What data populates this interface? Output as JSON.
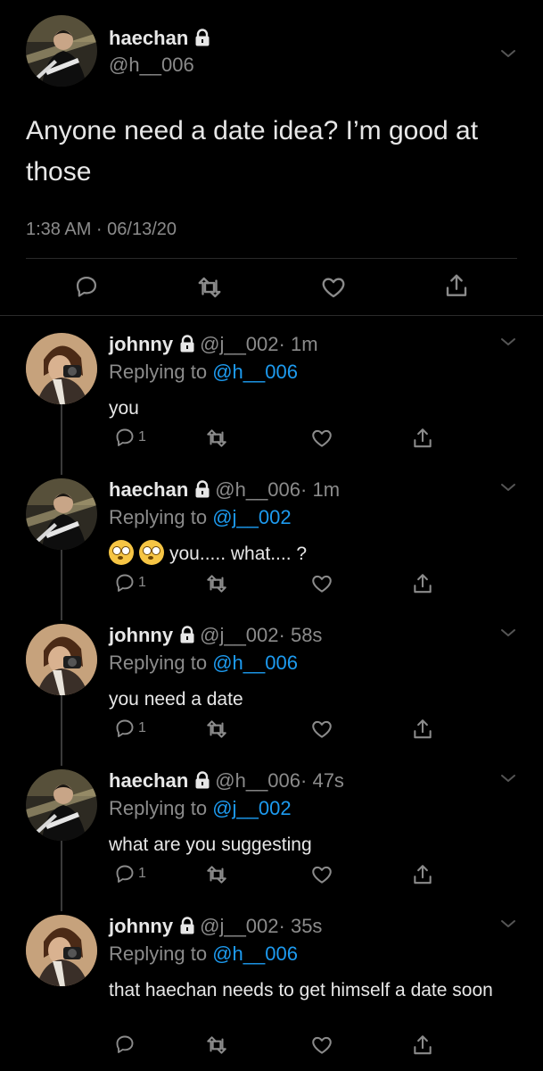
{
  "main_tweet": {
    "name": "haechan",
    "handle": "@h__006",
    "text": "Anyone need a date idea? I’m good at those",
    "timestamp": "1:38 AM · 06/13/20"
  },
  "replies": [
    {
      "name": "johnny",
      "handle": "@j__002",
      "time": "· 1m",
      "replying_prefix": "Replying to ",
      "replying_to": "@h__006",
      "text": "you",
      "reply_count": "1"
    },
    {
      "name": "haechan",
      "handle": "@h__006",
      "time": "· 1m",
      "replying_prefix": "Replying to ",
      "replying_to": "@j__002",
      "text": "you..... what.... ?",
      "reply_count": "1"
    },
    {
      "name": "johnny",
      "handle": "@j__002",
      "time": "· 58s",
      "replying_prefix": "Replying to ",
      "replying_to": "@h__006",
      "text": "you need a date",
      "reply_count": "1"
    },
    {
      "name": "haechan",
      "handle": "@h__006",
      "time": "· 47s",
      "replying_prefix": "Replying to ",
      "replying_to": "@j__002",
      "text": "what are you suggesting",
      "reply_count": "1"
    },
    {
      "name": "johnny",
      "handle": "@j__002",
      "time": "· 35s",
      "replying_prefix": "Replying to ",
      "replying_to": "@h__006",
      "text": "that haechan needs to get himself a date soon",
      "reply_count": ""
    }
  ],
  "colors": {
    "background": "#000000",
    "text": "#e7e7e7",
    "muted": "#8b8b8b",
    "link": "#1d9bf0"
  }
}
